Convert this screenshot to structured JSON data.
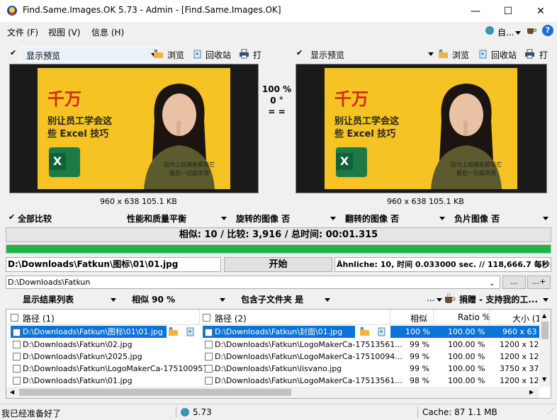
{
  "window": {
    "title": "Find.Same.Images.OK 5.73 - Admin - [Find.Same.Images.OK]",
    "minimize": "—",
    "maximize": "☐",
    "close": "✕"
  },
  "menu": {
    "file": "文件 (F)",
    "view": "视图 (V)",
    "info": "信息 (H)",
    "lang": "自...",
    "help": "?"
  },
  "left_panel": {
    "preview_select": "显示预览",
    "browse": "浏览",
    "recycle": "回收站",
    "print": "打",
    "image_info": "960 x 638 105.1 KB"
  },
  "right_panel": {
    "preview_select": "显示预览",
    "browse": "浏览",
    "recycle": "回收站",
    "print": "打",
    "image_info": "960 x 638 105.1 KB"
  },
  "compare_info": {
    "percent": "100 %",
    "angle": "0 °",
    "equal": "= ="
  },
  "preview_image": {
    "line1": "千万",
    "line2": "别让员工学会这",
    "line3": "些 Excel 技巧",
    "caption1": "因为上班摸鱼都靠它",
    "caption2": "最后一招超常用",
    "excel_letter": "X"
  },
  "options": {
    "compare_all": "全部比较",
    "balance": "性能和质量平衡",
    "rotated": "旋转的图像 否",
    "flipped": "翻转的图像 否",
    "negative": "负片图像 否"
  },
  "summary": "相似: 10 / 比较: 3,916 / 总时间: 00:01.315",
  "progress": 1.0,
  "search": {
    "current_file": "D:\\Downloads\\Fatkun\\图标\\01\\01.jpg",
    "start_button": "开始",
    "stats": "Ähnliche: 10, 时间 0.033000 sec. // 118,666.7 每秒.",
    "folder_path": "D:\\Downloads\\Fatkun",
    "browse_btn": "...",
    "add_btn": "...+"
  },
  "result_toolbar": {
    "show_list": "显示结果列表",
    "similarity": "相似 90 %",
    "subfolders": "包含子文件夹 是",
    "more": "...",
    "donate": "捐赠 - 支持我的工..."
  },
  "table": {
    "headers": [
      "路径 (1)",
      "路径 (2)",
      "相似",
      "Ratio %",
      "大小 (1"
    ],
    "rows": [
      {
        "path1": "D:\\Downloads\\Fatkun\\图标\\01\\01.jpg",
        "path2": "D:\\Downloads\\Fatkun\\封面\\01.jpg",
        "similar": "100 %",
        "ratio": "100.00 %",
        "size": "960 x 63"
      },
      {
        "path1": "D:\\Downloads\\Fatkun\\02.jpg",
        "path2": "D:\\Downloads\\Fatkun\\LogoMakerCa-17513561...",
        "similar": "99 %",
        "ratio": "100.00 %",
        "size": "1200 x 120"
      },
      {
        "path1": "D:\\Downloads\\Fatkun\\2025.jpg",
        "path2": "D:\\Downloads\\Fatkun\\LogoMakerCa-17510094...",
        "similar": "99 %",
        "ratio": "100.00 %",
        "size": "1200 x 120"
      },
      {
        "path1": "D:\\Downloads\\Fatkun\\LogoMakerCa-175100957...",
        "path2": "D:\\Downloads\\Fatkun\\lisvano.jpg",
        "similar": "99 %",
        "ratio": "100.00 %",
        "size": "3750 x 375"
      },
      {
        "path1": "D:\\Downloads\\Fatkun\\01.jpg",
        "path2": "D:\\Downloads\\Fatkun\\LogoMakerCa-17513561...",
        "similar": "98 %",
        "ratio": "100.00 %",
        "size": "1200 x 120"
      }
    ]
  },
  "statusbar": {
    "left": "我已经准备好了",
    "version": "5.73",
    "cache": "Cache: 87 1.1 MB"
  },
  "colors": {
    "accent": "#0a74d8",
    "progress": "#21b34a",
    "preview_bg": "#f6c324"
  }
}
